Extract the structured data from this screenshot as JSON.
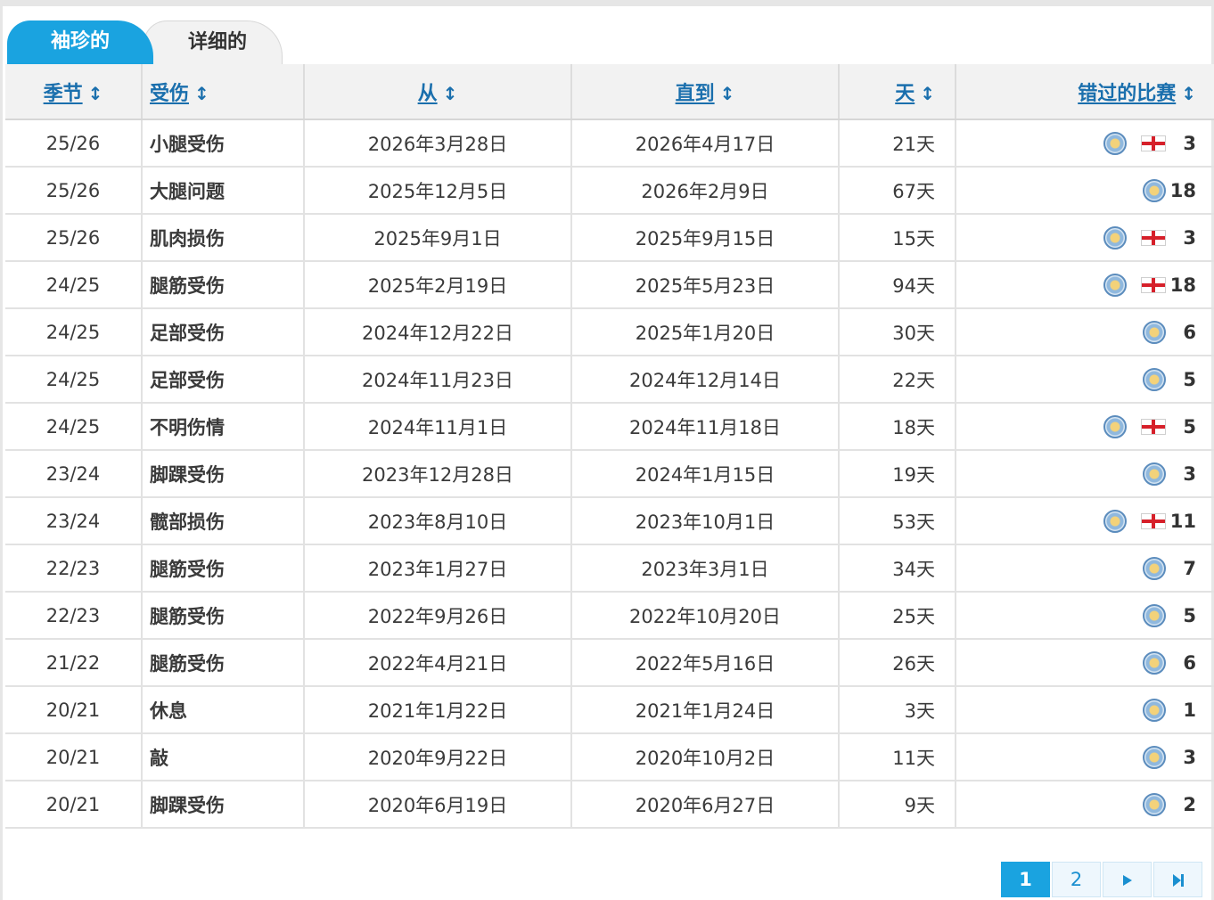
{
  "tabs": {
    "active": "袖珍的",
    "inactive": "详细的"
  },
  "headers": {
    "season": "季节",
    "injury": "受伤",
    "from": "从",
    "until": "直到",
    "days": "天",
    "missed": "错过的比赛",
    "sort_glyph": "↕"
  },
  "rows": [
    {
      "season": "25/26",
      "injury": "小腿受伤",
      "from": "2026年3月28日",
      "until": "2026年4月17日",
      "days": "21天",
      "national": true,
      "games": "3"
    },
    {
      "season": "25/26",
      "injury": "大腿问题",
      "from": "2025年12月5日",
      "until": "2026年2月9日",
      "days": "67天",
      "national": false,
      "games": "18"
    },
    {
      "season": "25/26",
      "injury": "肌肉损伤",
      "from": "2025年9月1日",
      "until": "2025年9月15日",
      "days": "15天",
      "national": true,
      "games": "3"
    },
    {
      "season": "24/25",
      "injury": "腿筋受伤",
      "from": "2025年2月19日",
      "until": "2025年5月23日",
      "days": "94天",
      "national": true,
      "games": "18"
    },
    {
      "season": "24/25",
      "injury": "足部受伤",
      "from": "2024年12月22日",
      "until": "2025年1月20日",
      "days": "30天",
      "national": false,
      "games": "6"
    },
    {
      "season": "24/25",
      "injury": "足部受伤",
      "from": "2024年11月23日",
      "until": "2024年12月14日",
      "days": "22天",
      "national": false,
      "games": "5"
    },
    {
      "season": "24/25",
      "injury": "不明伤情",
      "from": "2024年11月1日",
      "until": "2024年11月18日",
      "days": "18天",
      "national": true,
      "games": "5"
    },
    {
      "season": "23/24",
      "injury": "脚踝受伤",
      "from": "2023年12月28日",
      "until": "2024年1月15日",
      "days": "19天",
      "national": false,
      "games": "3"
    },
    {
      "season": "23/24",
      "injury": "髋部损伤",
      "from": "2023年8月10日",
      "until": "2023年10月1日",
      "days": "53天",
      "national": true,
      "games": "11"
    },
    {
      "season": "22/23",
      "injury": "腿筋受伤",
      "from": "2023年1月27日",
      "until": "2023年3月1日",
      "days": "34天",
      "national": false,
      "games": "7"
    },
    {
      "season": "22/23",
      "injury": "腿筋受伤",
      "from": "2022年9月26日",
      "until": "2022年10月20日",
      "days": "25天",
      "national": false,
      "games": "5"
    },
    {
      "season": "21/22",
      "injury": "腿筋受伤",
      "from": "2022年4月21日",
      "until": "2022年5月16日",
      "days": "26天",
      "national": false,
      "games": "6"
    },
    {
      "season": "20/21",
      "injury": "休息",
      "from": "2021年1月22日",
      "until": "2021年1月24日",
      "days": "3天",
      "national": false,
      "games": "1"
    },
    {
      "season": "20/21",
      "injury": "敲",
      "from": "2020年9月22日",
      "until": "2020年10月2日",
      "days": "11天",
      "national": false,
      "games": "3"
    },
    {
      "season": "20/21",
      "injury": "脚踝受伤",
      "from": "2020年6月19日",
      "until": "2020年6月27日",
      "days": "9天",
      "national": false,
      "games": "2"
    }
  ],
  "pagination": {
    "pages": [
      "1",
      "2"
    ],
    "current": "1",
    "next_icon": "next-icon",
    "last_icon": "last-page-icon"
  },
  "colors": {
    "accent": "#1aa3e0",
    "header_link": "#1a6fad"
  }
}
